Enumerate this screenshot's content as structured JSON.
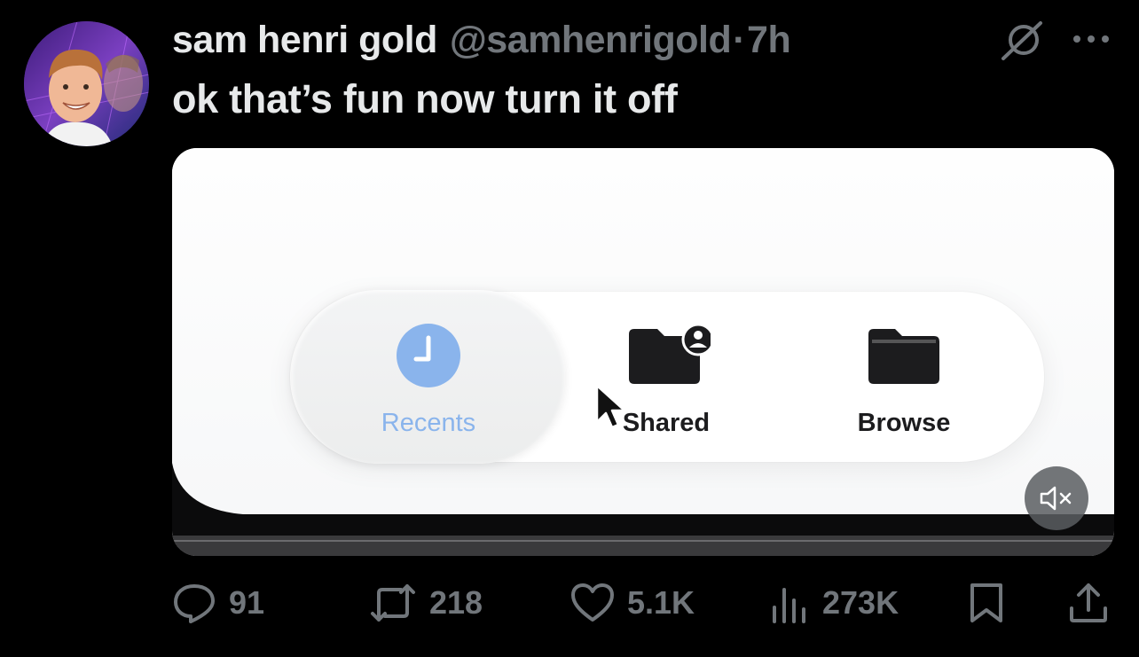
{
  "tweet": {
    "author_name": "sam henri gold",
    "handle": "@samhenrigold",
    "separator": "·",
    "time_ago": "7h",
    "text": "ok that’s fun now turn it off"
  },
  "media": {
    "tabs": [
      {
        "label": "Recents",
        "icon": "clock-icon",
        "selected": true
      },
      {
        "label": "Shared",
        "icon": "shared-folder-icon",
        "selected": false
      },
      {
        "label": "Browse",
        "icon": "folder-icon",
        "selected": false
      }
    ],
    "mute_icon": "speaker-muted-icon"
  },
  "actions": {
    "replies": "91",
    "reposts": "218",
    "likes": "5.1K",
    "views": "273K"
  },
  "colors": {
    "background": "#000000",
    "text_primary": "#e7e9ea",
    "text_secondary": "#71767b",
    "selected_tab_accent": "#8ab4ec"
  }
}
